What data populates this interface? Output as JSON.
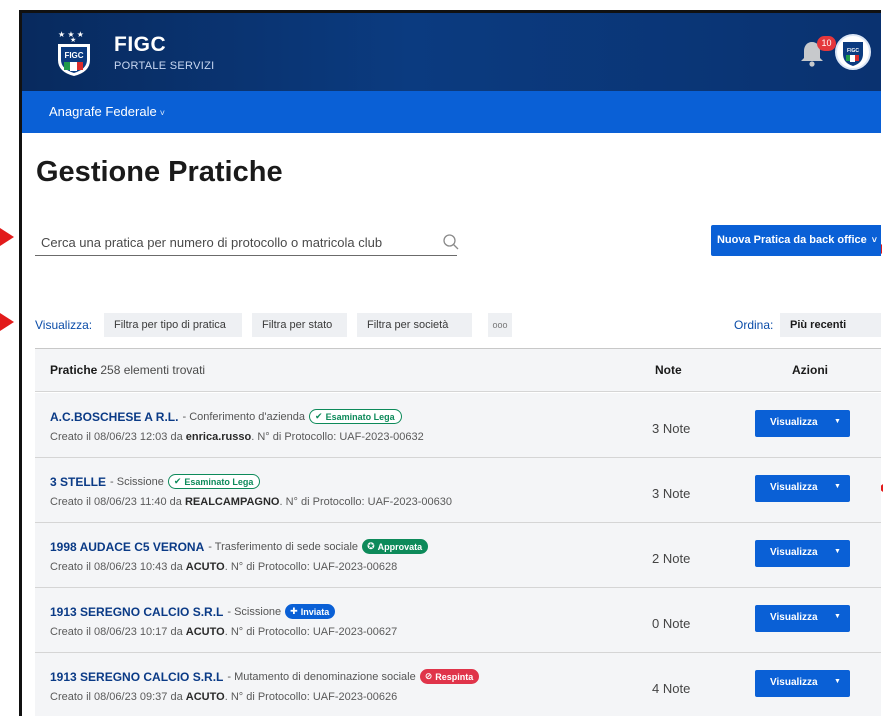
{
  "header": {
    "brand_title": "FIGC",
    "brand_subtitle": "PORTALE SERVIZI",
    "notification_count": "10",
    "logo_icon": "figc-shield-logo",
    "avatar_icon": "figc-avatar-icon"
  },
  "nav": {
    "items": [
      {
        "label": "Anagrafe Federale",
        "chevron": "˅"
      }
    ]
  },
  "page": {
    "title": "Gestione Pratiche"
  },
  "search": {
    "placeholder": "Cerca una pratica per numero di protocollo o matricola club"
  },
  "new_button": {
    "label": "Nuova Pratica da back office",
    "chevron": "˅"
  },
  "filters": {
    "label": "Visualizza:",
    "items": [
      "Filtra per tipo di pratica",
      "Filtra per stato",
      "Filtra per società"
    ],
    "more": "ooo",
    "order_label": "Ordina:",
    "order_value": "Più recenti"
  },
  "table": {
    "title": "Pratiche",
    "count": "258 elementi trovati",
    "col_note": "Note",
    "col_actions": "Azioni",
    "rows": [
      {
        "club": "A.C.BOSCHESE A R.L.",
        "type": "- Conferimento d'azienda",
        "badge": "Esaminato Lega",
        "created_prefix": "Creato il 08/06/23 12:03 da",
        "user": "enrica.russo",
        "protocol": ". N° di Protocollo: UAF-2023-00632",
        "note": "3 Note",
        "action": "Visualizza"
      },
      {
        "club": "3 STELLE",
        "type": "- Scissione",
        "badge": "Esaminato Lega",
        "created_prefix": "Creato il 08/06/23 11:40 da",
        "user": "REALCAMPAGNO",
        "protocol": ". N° di Protocollo: UAF-2023-00630",
        "note": "3 Note",
        "action": "Visualizza"
      },
      {
        "club": "1998 AUDACE C5 VERONA",
        "type": "- Trasferimento di sede sociale",
        "badge": "Approvata",
        "created_prefix": "Creato il 08/06/23 10:43 da",
        "user": "ACUTO",
        "protocol": ". N° di Protocollo: UAF-2023-00628",
        "note": "2 Note",
        "action": "Visualizza"
      },
      {
        "club": "1913 SEREGNO CALCIO S.R.L",
        "type": "- Scissione",
        "badge": "Inviata",
        "created_prefix": "Creato il 08/06/23 10:17 da",
        "user": "ACUTO",
        "protocol": ". N° di Protocollo: UAF-2023-00627",
        "note": "0 Note",
        "action": "Visualizza"
      },
      {
        "club": "1913 SEREGNO CALCIO S.R.L",
        "type": "- Mutamento di denominazione sociale",
        "badge": "Respinta",
        "created_prefix": "Creato il 08/06/23 09:37 da",
        "user": "ACUTO",
        "protocol": ". N° di Protocollo: UAF-2023-00626",
        "note": "4 Note",
        "action": "Visualizza"
      }
    ]
  },
  "colors": {
    "header_dark": "#082a5e",
    "primary": "#0a60d6",
    "club_link": "#0a3a86",
    "status_green": "#0d8a5a",
    "status_red": "#e0344a",
    "row_bg": "#f4f5f7",
    "annotation_marker": "#e21b1b"
  }
}
